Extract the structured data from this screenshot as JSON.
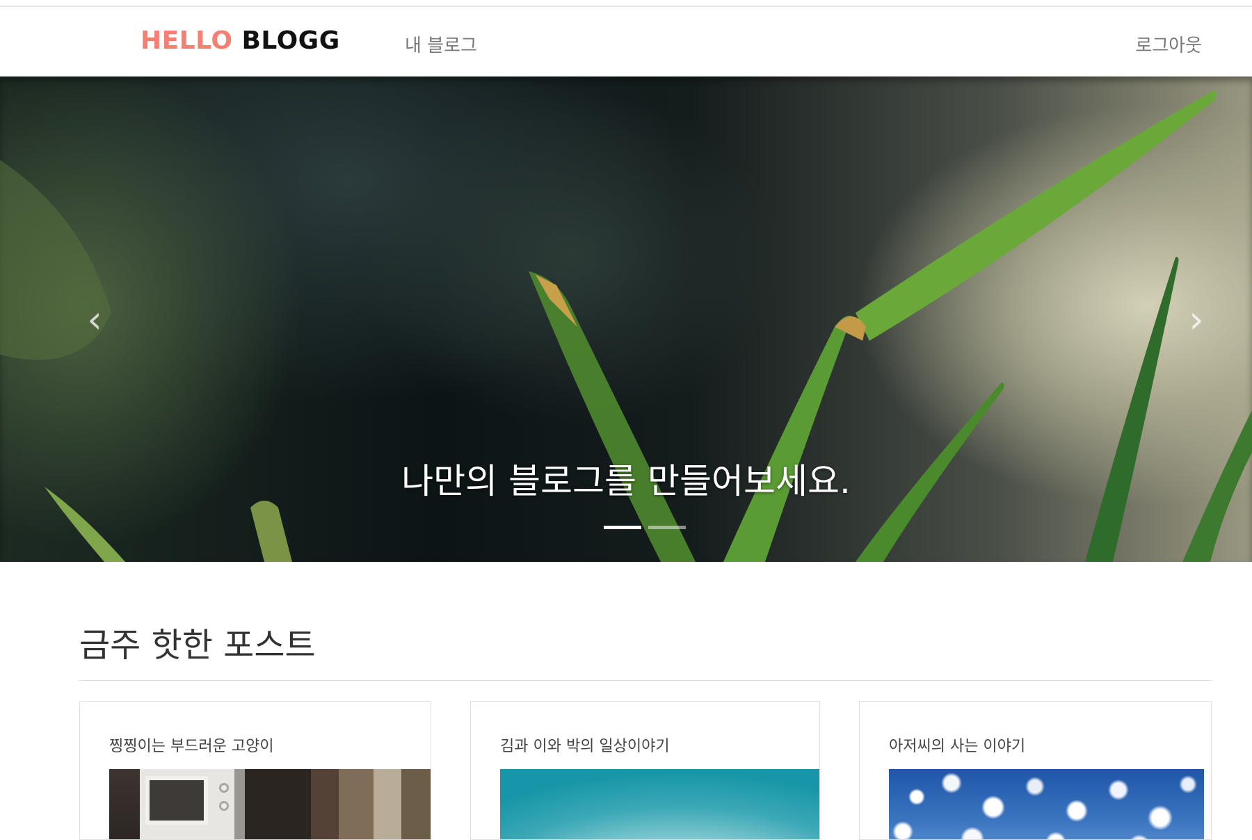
{
  "navbar": {
    "brand_hello": "HELLO",
    "brand_blogg": "BLOGG",
    "my_blog_label": "내 블로그",
    "logout_label": "로그아웃"
  },
  "hero": {
    "caption": "나만의 블로그를 만들어보세요.",
    "prev_arrow": "‹",
    "next_arrow": "›",
    "slide_count": 2,
    "active_slide": 1
  },
  "hot_posts": {
    "title": "금주 핫한 포스트",
    "cards": [
      {
        "title": "찡찡이는 부드러운 고양이",
        "thumbnail": "cat-photo"
      },
      {
        "title": "김과 이와 박의 일상이야기",
        "thumbnail": "teal-sky-photo"
      },
      {
        "title": "아저씨의 사는 이야기",
        "thumbnail": "cloud-sky-photo"
      }
    ]
  },
  "colors": {
    "brand_accent": "#f47f72",
    "brand_dark": "#111111",
    "nav_text": "#777777"
  }
}
